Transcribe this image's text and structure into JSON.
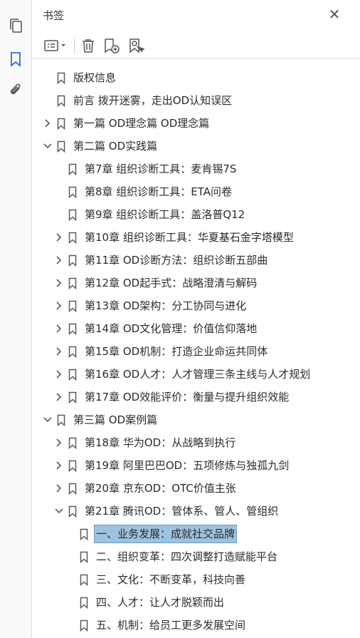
{
  "rail": {
    "items": [
      {
        "name": "pages-icon"
      },
      {
        "name": "bookmark-icon"
      },
      {
        "name": "paperclip-icon"
      }
    ],
    "active_color": "#2a6fd6"
  },
  "panel": {
    "title": "书签",
    "close_glyph": "✕"
  },
  "toolbar": {
    "buttons": [
      "options-menu-icon",
      "delete-icon",
      "new-bookmark-icon",
      "bookmark-from-selection-icon"
    ]
  },
  "bookmarks": [
    {
      "label": "版权信息",
      "level": 0,
      "expand": "none"
    },
    {
      "label": "前言 拨开迷雾，走出OD认知误区",
      "level": 0,
      "expand": "none"
    },
    {
      "label": "第一篇 OD理念篇 OD理念篇",
      "level": 0,
      "expand": "collapsed"
    },
    {
      "label": "第二篇 OD实践篇",
      "level": 0,
      "expand": "expanded"
    },
    {
      "label": "第7章 组织诊断工具：麦肯锡7S",
      "level": 1,
      "expand": "none"
    },
    {
      "label": "第8章 组织诊断工具：ETA问卷",
      "level": 1,
      "expand": "none"
    },
    {
      "label": "第9章 组织诊断工具：盖洛普Q12",
      "level": 1,
      "expand": "none"
    },
    {
      "label": "第10章 组织诊断工具：华夏基石金字塔模型",
      "level": 1,
      "expand": "collapsed"
    },
    {
      "label": "第11章 OD诊断方法：组织诊断五部曲",
      "level": 1,
      "expand": "collapsed"
    },
    {
      "label": "第12章 OD起手式：战略澄清与解码",
      "level": 1,
      "expand": "collapsed"
    },
    {
      "label": "第13章 OD架构：分工协同与进化",
      "level": 1,
      "expand": "collapsed"
    },
    {
      "label": "第14章 OD文化管理：价值信仰落地",
      "level": 1,
      "expand": "collapsed"
    },
    {
      "label": "第15章 OD机制：打造企业命运共同体",
      "level": 1,
      "expand": "collapsed"
    },
    {
      "label": "第16章 OD人才：人才管理三条主线与人才规划",
      "level": 1,
      "expand": "collapsed"
    },
    {
      "label": "第17章 OD效能评价：衡量与提升组织效能",
      "level": 1,
      "expand": "collapsed"
    },
    {
      "label": "第三篇 OD案例篇",
      "level": 0,
      "expand": "expanded"
    },
    {
      "label": "第18章 华为OD：从战略到执行",
      "level": 1,
      "expand": "collapsed"
    },
    {
      "label": "第19章 阿里巴巴OD：五项修炼与独孤九剑",
      "level": 1,
      "expand": "collapsed"
    },
    {
      "label": "第20章 京东OD：OTC价值主张",
      "level": 1,
      "expand": "collapsed"
    },
    {
      "label": "第21章 腾讯OD：管体系、管人、管组织",
      "level": 1,
      "expand": "expanded"
    },
    {
      "label": "一、业务发展：成就社交品牌",
      "level": 2,
      "expand": "none",
      "selected": true
    },
    {
      "label": "二、组织变革：四次调整打造赋能平台",
      "level": 2,
      "expand": "none"
    },
    {
      "label": "三、文化：不断变革，科技向善",
      "level": 2,
      "expand": "none"
    },
    {
      "label": "四、人才：让人才脱颖而出",
      "level": 2,
      "expand": "none"
    },
    {
      "label": "五、机制：给员工更多发展空间",
      "level": 2,
      "expand": "none"
    }
  ],
  "colors": {
    "selection_bg": "#9ec3e0",
    "icon_gray": "#5b5b5b"
  }
}
